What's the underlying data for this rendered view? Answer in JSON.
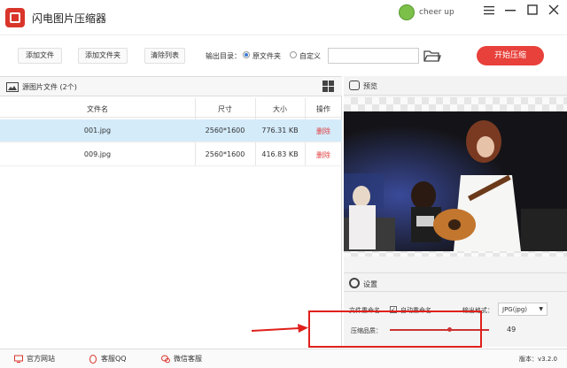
{
  "app": {
    "title": "闪电图片压缩器",
    "user_name": "cheer up",
    "window_controls": [
      "minimize-icon",
      "maximize-icon",
      "close-icon"
    ]
  },
  "toolbar": {
    "add_file": "添加文件",
    "add_folder": "添加文件夹",
    "clear_list": "清除列表",
    "output_dir_label": "输出目录：",
    "option_source": "原文件夹",
    "option_custom": "自定义",
    "path_value": "",
    "start": "开始压缩"
  },
  "file_list": {
    "title": "源图片文件 (2个)",
    "columns": [
      "文件名",
      "尺寸",
      "大小",
      "操作"
    ],
    "rows": [
      {
        "name": "001.jpg",
        "size": "2560*1600",
        "filesize": "776.31 KB",
        "action": "删除",
        "selected": true
      },
      {
        "name": "009.jpg",
        "size": "2560*1600",
        "filesize": "416.83 KB",
        "action": "删除",
        "selected": false
      }
    ]
  },
  "preview": {
    "title": "预览"
  },
  "settings": {
    "title": "设置",
    "rename_label": "文件重命名",
    "auto_rename": "自动重命名",
    "auto_rename_checked": true,
    "format_label": "输出格式：",
    "format_value": "JPG(jpg)",
    "quality_label": "压缩品质：",
    "quality_value": "49",
    "quality_fraction": 0.6
  },
  "bottombar": {
    "website": "官方网站",
    "qq": "客服QQ",
    "wechat": "微信客服",
    "version": "版本：v3.2.0"
  },
  "colors": {
    "accent": "#e8403a",
    "selected_row": "#d4ebfa",
    "highlight": "#e0201b"
  }
}
